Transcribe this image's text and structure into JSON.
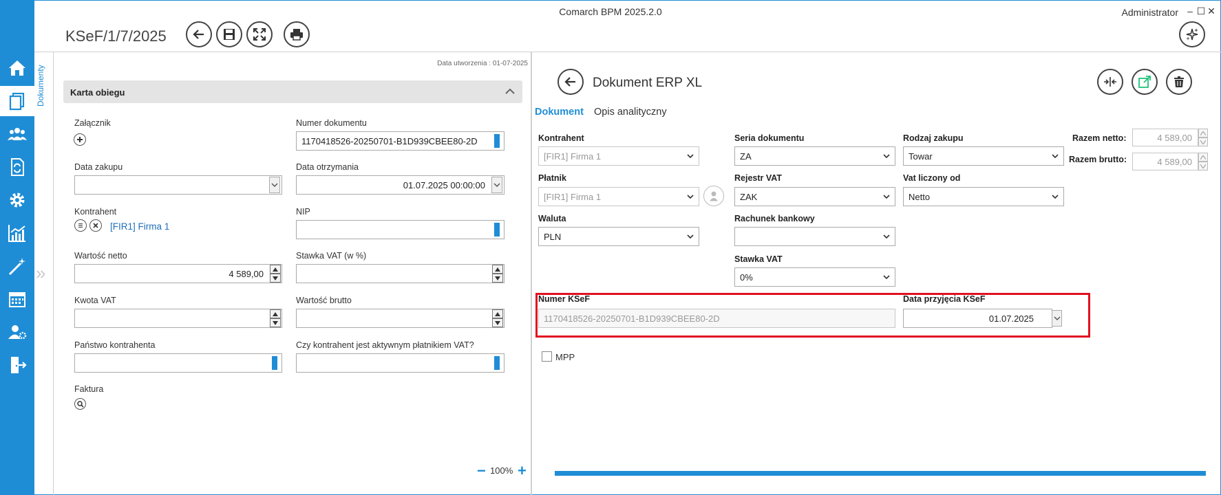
{
  "app": {
    "title": "Comarch BPM 2025.2.0",
    "user": "Administrator",
    "window_controls": [
      "–",
      "☐",
      "✕"
    ]
  },
  "header": {
    "doc_title": "KSeF/1/7/2025"
  },
  "sidebar": {
    "items": [
      {
        "name": "home",
        "icon": "home-icon"
      },
      {
        "name": "documents",
        "icon": "documents-icon",
        "active": true
      },
      {
        "name": "contacts",
        "icon": "people-icon"
      },
      {
        "name": "workflow",
        "icon": "refresh-doc-icon"
      },
      {
        "name": "settings",
        "icon": "gear-icon"
      },
      {
        "name": "reports",
        "icon": "chart-icon"
      },
      {
        "name": "wizard",
        "icon": "magic-wand-icon"
      },
      {
        "name": "calendar",
        "icon": "calendar-icon"
      },
      {
        "name": "users-settings",
        "icon": "user-gear-icon"
      },
      {
        "name": "logout",
        "icon": "exit-icon"
      }
    ],
    "vertical_tab": "Dokumenty"
  },
  "left": {
    "created": "Data utworzenia : 01-07-2025",
    "card_title": "Karta obiegu",
    "fields": {
      "attachment_label": "Załącznik",
      "doc_number_label": "Numer dokumentu",
      "doc_number_value": "1170418526-20250701-B1D939CBEE80-2D",
      "purchase_date_label": "Data zakupu",
      "receipt_date_label": "Data otrzymania",
      "receipt_date_value": "01.07.2025 00:00:00",
      "contractor_label": "Kontrahent",
      "contractor_value": "[FIR1] Firma 1",
      "nip_label": "NIP",
      "net_label": "Wartość netto",
      "net_value": "4 589,00",
      "vat_rate_label": "Stawka VAT (w %)",
      "vat_amount_label": "Kwota VAT",
      "gross_label": "Wartość brutto",
      "country_label": "Państwo kontrahenta",
      "vat_active_label": "Czy kontrahent jest aktywnym płatnikiem VAT?",
      "invoice_label": "Faktura"
    },
    "zoom": "100%"
  },
  "right": {
    "title": "Dokument ERP XL",
    "tabs": [
      "Dokument",
      "Opis analityczny"
    ],
    "fields": {
      "contractor_label": "Kontrahent",
      "contractor_value": "[FIR1] Firma 1",
      "payer_label": "Płatnik",
      "payer_value": "[FIR1] Firma 1",
      "currency_label": "Waluta",
      "currency_value": "PLN",
      "series_label": "Seria dokumentu",
      "series_value": "ZA",
      "vat_register_label": "Rejestr VAT",
      "vat_register_value": "ZAK",
      "bank_account_label": "Rachunek bankowy",
      "bank_account_value": "",
      "vat_rate_label": "Stawka VAT",
      "vat_rate_value": "0%",
      "purchase_type_label": "Rodzaj zakupu",
      "purchase_type_value": "Towar",
      "vat_calc_label": "Vat liczony od",
      "vat_calc_value": "Netto",
      "net_total_label": "Razem netto:",
      "net_total_value": "4 589,00",
      "gross_total_label": "Razem brutto:",
      "gross_total_value": "4 589,00",
      "ksef_number_label": "Numer KSeF",
      "ksef_number_value": "1170418526-20250701-B1D939CBEE80-2D",
      "ksef_date_label": "Data przyjęcia KSeF",
      "ksef_date_value": "01.07.2025",
      "mpp_label": "MPP"
    }
  },
  "colors": {
    "accent": "#1f8dd6",
    "highlight": "#e01020",
    "link": "#1f6fb8"
  }
}
